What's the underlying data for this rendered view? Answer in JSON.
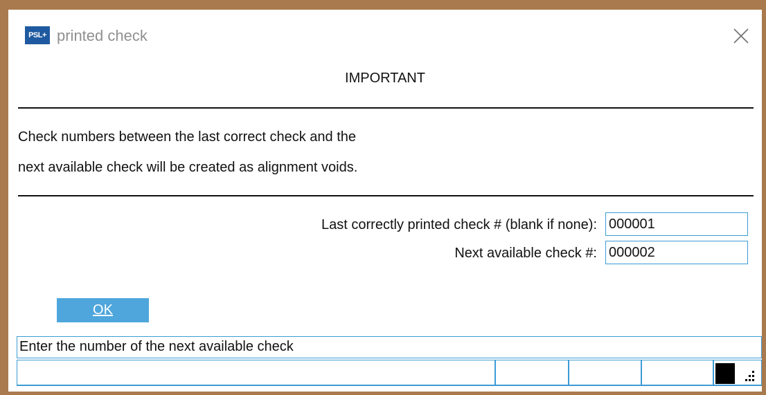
{
  "window": {
    "title": "printed check",
    "app_icon_label": "PSL+"
  },
  "dialog": {
    "heading": "IMPORTANT",
    "message_lines": [
      "Check numbers between the last correct check and the",
      "next available check will be created as alignment voids."
    ],
    "fields": [
      {
        "label": "Last correctly printed check # (blank if none):",
        "value": "000001"
      },
      {
        "label": "Next available check #:",
        "value": "000002"
      }
    ],
    "ok_button": {
      "label": "OK"
    }
  },
  "status": {
    "message": "Enter the number of the next available check",
    "segments": [
      "",
      "",
      "",
      ""
    ]
  },
  "icons": {
    "app": "app-logo-icon",
    "close": "close-icon",
    "indicator": "status-indicator-icon",
    "grip": "resize-grip-icon"
  },
  "colors": {
    "accent": "#4ea6dc",
    "field_border": "#3c9bd6",
    "desktop_background": "#a97a4d",
    "title_text": "#8f8f8f"
  }
}
